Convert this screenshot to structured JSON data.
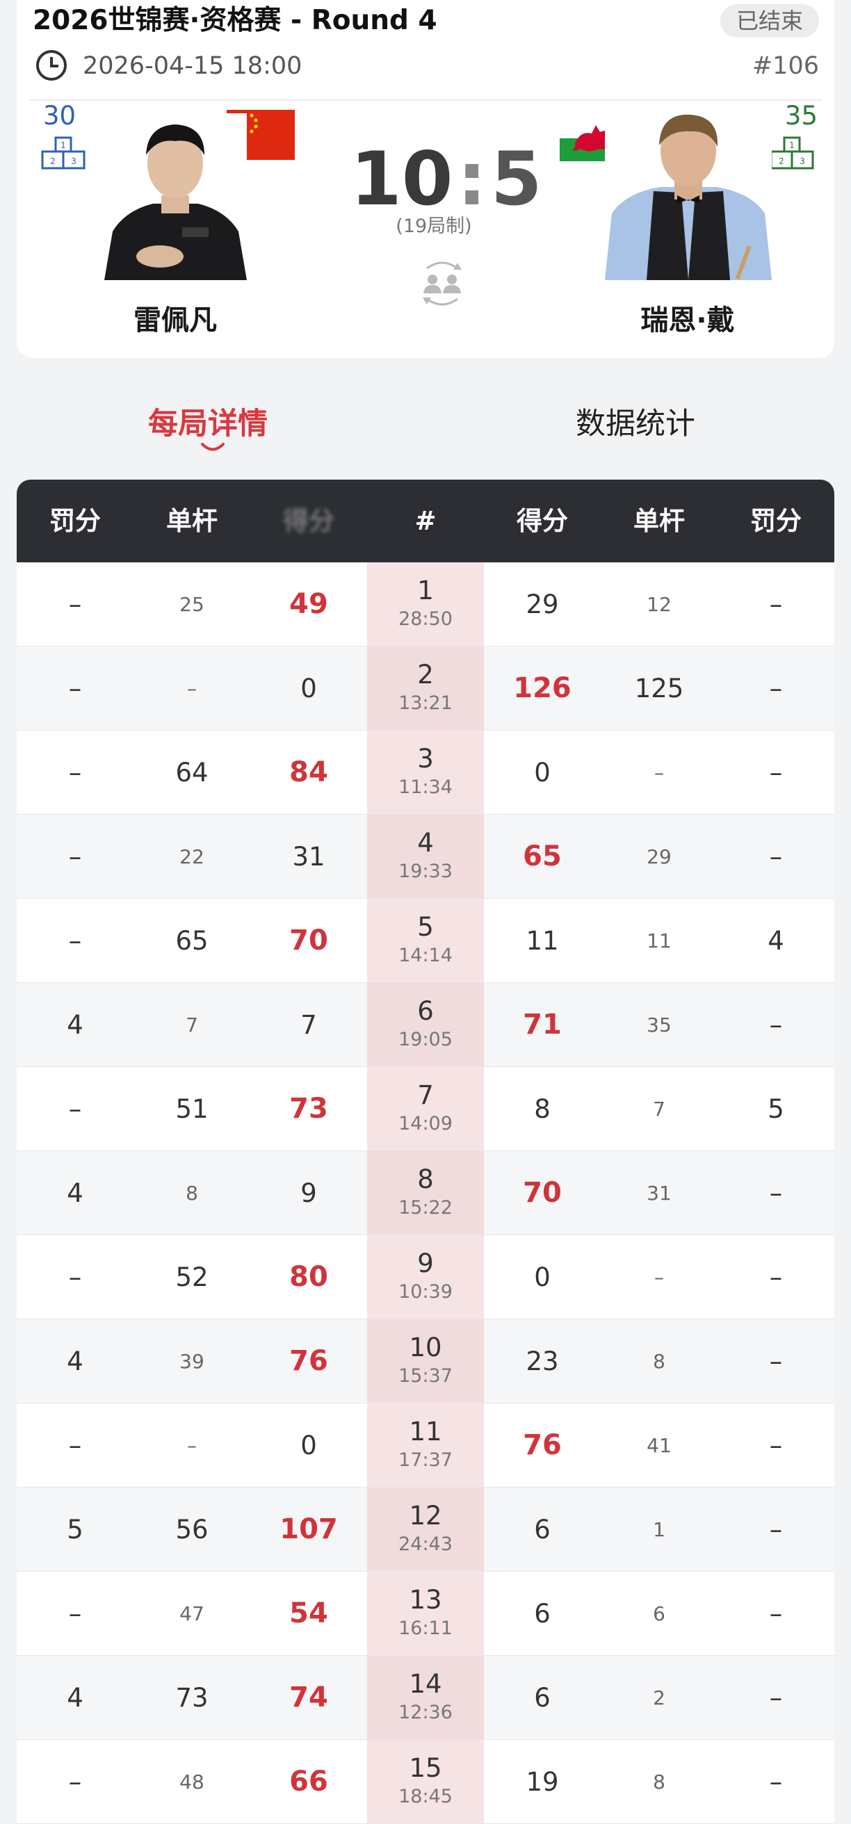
{
  "header": {
    "title": "2026世锦赛·资格赛 - Round 4",
    "status": "已结束",
    "datetime": "2026-04-15 18:00",
    "match_no": "#106"
  },
  "players": {
    "left": {
      "name": "雷佩凡",
      "seed": "30",
      "flag": "China"
    },
    "right": {
      "name": "瑞恩·戴",
      "seed": "35",
      "flag": "Wales"
    }
  },
  "score": {
    "left": "10",
    "separator": ":",
    "right": "5",
    "format": "(19局制)"
  },
  "tabs": {
    "detail": "每局详情",
    "stats": "数据统计"
  },
  "table": {
    "headers": [
      "罚分",
      "单杆",
      "得分",
      "#",
      "得分",
      "单杆",
      "罚分"
    ],
    "frames": [
      {
        "no": "1",
        "time": "28:50",
        "l_pen": "–",
        "l_break": "25",
        "l_score": "49",
        "r_score": "29",
        "r_break": "12",
        "r_pen": "–",
        "winner": "left"
      },
      {
        "no": "2",
        "time": "13:21",
        "l_pen": "–",
        "l_break": "–",
        "l_score": "0",
        "r_score": "126",
        "r_break": "125",
        "r_pen": "–",
        "winner": "right"
      },
      {
        "no": "3",
        "time": "11:34",
        "l_pen": "–",
        "l_break": "64",
        "l_score": "84",
        "r_score": "0",
        "r_break": "–",
        "r_pen": "–",
        "winner": "left"
      },
      {
        "no": "4",
        "time": "19:33",
        "l_pen": "–",
        "l_break": "22",
        "l_score": "31",
        "r_score": "65",
        "r_break": "29",
        "r_pen": "–",
        "winner": "right"
      },
      {
        "no": "5",
        "time": "14:14",
        "l_pen": "–",
        "l_break": "65",
        "l_score": "70",
        "r_score": "11",
        "r_break": "11",
        "r_pen": "4",
        "winner": "left"
      },
      {
        "no": "6",
        "time": "19:05",
        "l_pen": "4",
        "l_break": "7",
        "l_score": "7",
        "r_score": "71",
        "r_break": "35",
        "r_pen": "–",
        "winner": "right"
      },
      {
        "no": "7",
        "time": "14:09",
        "l_pen": "–",
        "l_break": "51",
        "l_score": "73",
        "r_score": "8",
        "r_break": "7",
        "r_pen": "5",
        "winner": "left"
      },
      {
        "no": "8",
        "time": "15:22",
        "l_pen": "4",
        "l_break": "8",
        "l_score": "9",
        "r_score": "70",
        "r_break": "31",
        "r_pen": "–",
        "winner": "right"
      },
      {
        "no": "9",
        "time": "10:39",
        "l_pen": "–",
        "l_break": "52",
        "l_score": "80",
        "r_score": "0",
        "r_break": "–",
        "r_pen": "–",
        "winner": "left"
      },
      {
        "no": "10",
        "time": "15:37",
        "l_pen": "4",
        "l_break": "39",
        "l_score": "76",
        "r_score": "23",
        "r_break": "8",
        "r_pen": "–",
        "winner": "left"
      },
      {
        "no": "11",
        "time": "17:37",
        "l_pen": "–",
        "l_break": "–",
        "l_score": "0",
        "r_score": "76",
        "r_break": "41",
        "r_pen": "–",
        "winner": "right"
      },
      {
        "no": "12",
        "time": "24:43",
        "l_pen": "5",
        "l_break": "56",
        "l_score": "107",
        "r_score": "6",
        "r_break": "1",
        "r_pen": "–",
        "winner": "left"
      },
      {
        "no": "13",
        "time": "16:11",
        "l_pen": "–",
        "l_break": "47",
        "l_score": "54",
        "r_score": "6",
        "r_break": "6",
        "r_pen": "–",
        "winner": "left"
      },
      {
        "no": "14",
        "time": "12:36",
        "l_pen": "4",
        "l_break": "73",
        "l_score": "74",
        "r_score": "6",
        "r_break": "2",
        "r_pen": "–",
        "winner": "left"
      },
      {
        "no": "15",
        "time": "18:45",
        "l_pen": "–",
        "l_break": "48",
        "l_score": "66",
        "r_score": "19",
        "r_break": "8",
        "r_pen": "–",
        "winner": "left"
      }
    ]
  },
  "colors": {
    "accent": "#d9383e",
    "header_bg": "#2c2e33",
    "frame_col": "#f6e3e4",
    "seed_left": "#2f62b3",
    "seed_right": "#2b7a35"
  }
}
